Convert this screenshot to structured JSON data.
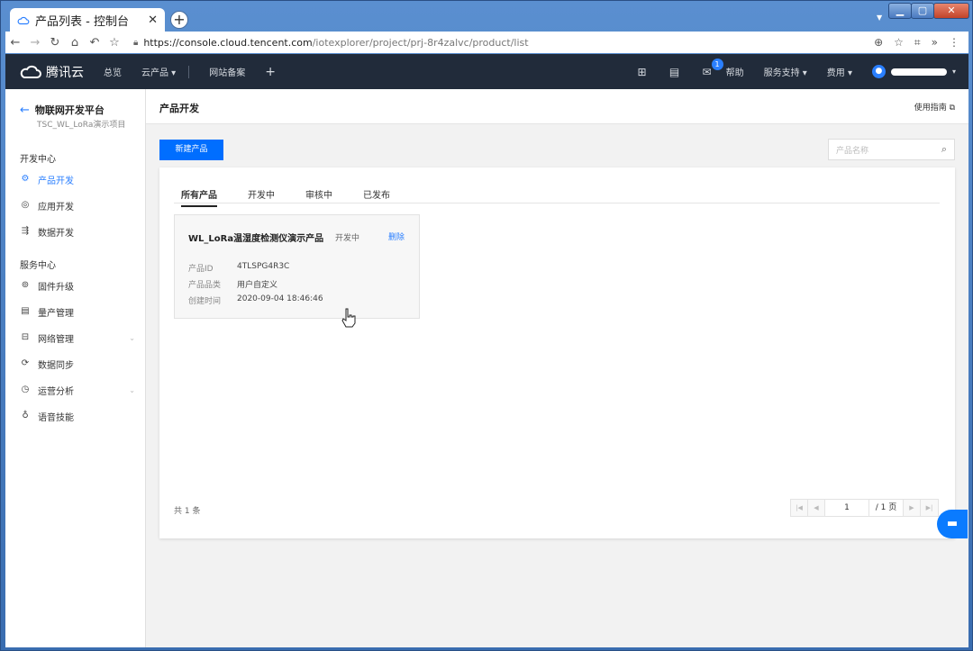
{
  "browser": {
    "tab_title": "产品列表 - 控制台",
    "tab_close": "✕",
    "new_tab": "+",
    "url_host": "https://console.cloud.tencent.com",
    "url_path": "/iotexplorer/project/prj-8r4zalvc/product/list",
    "window_min": "▁",
    "window_max": "▢",
    "window_close": "✕"
  },
  "topnav": {
    "brand": "腾讯云",
    "overview": "总览",
    "products": "云产品 ▾",
    "icp": "网站备案",
    "plus": "+",
    "message_count": "1",
    "help": "帮助",
    "support": "服务支持 ▾",
    "billing": "费用 ▾"
  },
  "sidebar": {
    "platform": "物联网开发平台",
    "project": "TSC_WL_LoRa演示项目",
    "section_dev": "开发中心",
    "section_service": "服务中心",
    "dev_items": [
      {
        "label": "产品开发",
        "icon": "gear-icon"
      },
      {
        "label": "应用开发",
        "icon": "app-icon"
      },
      {
        "label": "数据开发",
        "icon": "data-flow-icon"
      }
    ],
    "service_items": [
      {
        "label": "固件升级",
        "icon": "upgrade-icon"
      },
      {
        "label": "量产管理",
        "icon": "mass-production-icon"
      },
      {
        "label": "网络管理",
        "icon": "network-icon"
      },
      {
        "label": "数据同步",
        "icon": "sync-icon"
      },
      {
        "label": "运营分析",
        "icon": "analytics-icon"
      },
      {
        "label": "语音技能",
        "icon": "voice-icon"
      }
    ]
  },
  "page": {
    "title": "产品开发",
    "guide": "使用指南 ⧉",
    "new_product": "新建产品",
    "search_placeholder": "产品名称",
    "tabs": [
      "所有产品",
      "开发中",
      "审核中",
      "已发布"
    ],
    "card": {
      "name": "WL_LoRa温湿度检测仪演示产品",
      "status": "开发中",
      "delete": "删除",
      "fields": [
        {
          "k": "产品ID",
          "v": "4TLSPG4R3C"
        },
        {
          "k": "产品品类",
          "v": "用户自定义"
        },
        {
          "k": "创建时间",
          "v": "2020-09-04 18:46:46"
        }
      ]
    },
    "total": "共 1 条",
    "pager_current": "1",
    "pager_total": "/ 1 页"
  },
  "colors": {
    "accent": "#006eff",
    "topnav_bg": "#212b3a"
  }
}
